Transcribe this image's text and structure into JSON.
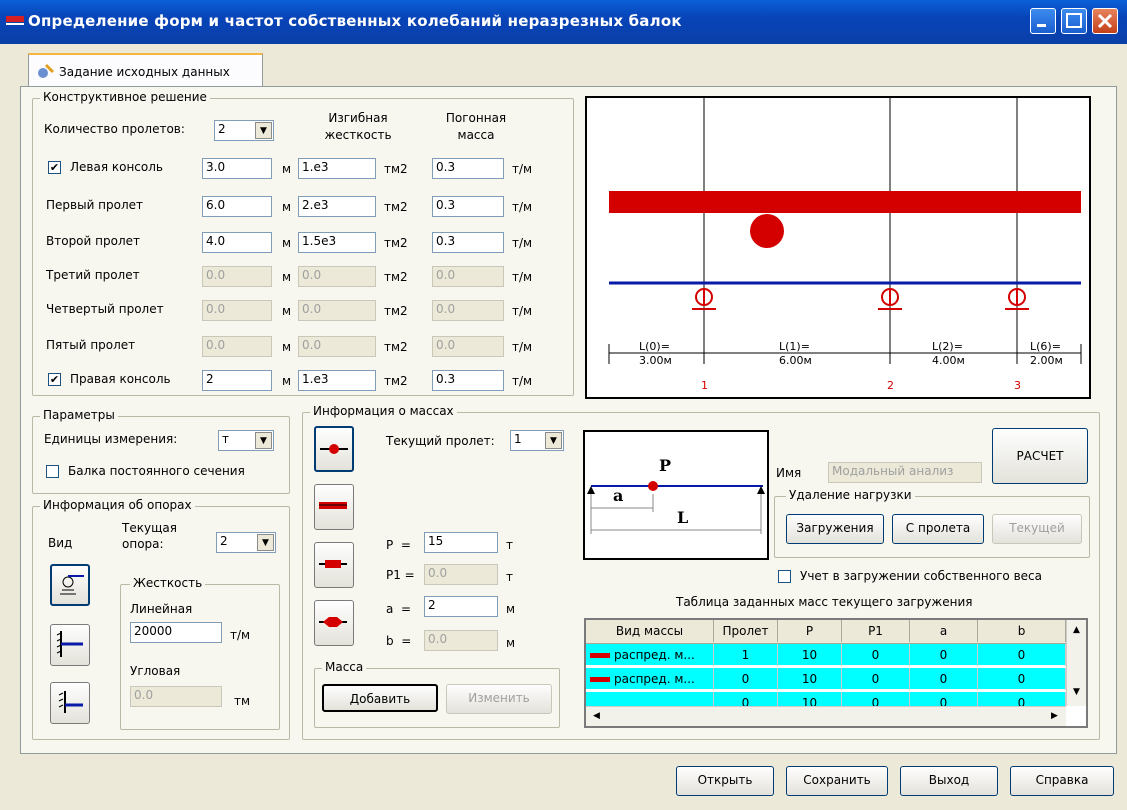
{
  "window": {
    "title": "Определение форм и частот собственных колебаний неразрезных балок"
  },
  "tab": {
    "label": "Задание исходных данных"
  },
  "structure": {
    "group_label": "Конструктивное решение",
    "span_count_label": "Количество пролетов:",
    "span_count_value": "2",
    "col_stiffness": "Изгибная\nжесткость",
    "col_mass": "Погонная\nмасса",
    "rows": [
      {
        "label": "Левая консоль",
        "checkbox": true,
        "checked": true,
        "len": "3.0",
        "stiff": "1.e3",
        "mass": "0.3",
        "enabled": true
      },
      {
        "label": "Первый пролет",
        "checkbox": false,
        "len": "6.0",
        "stiff": "2.e3",
        "mass": "0.3",
        "enabled": true
      },
      {
        "label": "Второй пролет",
        "checkbox": false,
        "len": "4.0",
        "stiff": "1.5e3",
        "mass": "0.3",
        "enabled": true
      },
      {
        "label": "Третий пролет",
        "checkbox": false,
        "len": "0.0",
        "stiff": "0.0",
        "mass": "0.0",
        "enabled": false
      },
      {
        "label": "Четвертый пролет",
        "checkbox": false,
        "len": "0.0",
        "stiff": "0.0",
        "mass": "0.0",
        "enabled": false
      },
      {
        "label": "Пятый пролет",
        "checkbox": false,
        "len": "0.0",
        "stiff": "0.0",
        "mass": "0.0",
        "enabled": false
      },
      {
        "label": "Правая консоль",
        "checkbox": true,
        "checked": true,
        "len": "2",
        "stiff": "1.e3",
        "mass": "0.3",
        "enabled": true
      }
    ],
    "unit_len": "м",
    "unit_stiff": "тм2",
    "unit_mass": "т/м"
  },
  "diagram": {
    "labels": [
      {
        "top": "L(0)=",
        "bottom": "3.00м"
      },
      {
        "top": "L(1)=",
        "bottom": "6.00м"
      },
      {
        "top": "L(2)=",
        "bottom": "4.00м"
      },
      {
        "top": "L(6)=",
        "bottom": "2.00м"
      }
    ],
    "support_numbers": [
      "1",
      "2",
      "3"
    ],
    "colors": {
      "beam": "#d40000",
      "axis": "#0a1aa8"
    }
  },
  "params": {
    "group_label": "Параметры",
    "units_label": "Единицы измерения:",
    "units_value": "т",
    "constant_section_label": "Балка постоянного сечения"
  },
  "supports": {
    "group_label": "Информация об опорах",
    "view_label": "Вид",
    "current_label": "Текущая\nопора:",
    "current_value": "2",
    "stiffness_group": "Жесткость",
    "linear_label": "Линейная",
    "linear_value": "20000",
    "linear_unit": "т/м",
    "angular_label": "Угловая",
    "angular_value": "0.0",
    "angular_unit": "тм"
  },
  "masses": {
    "group_label": "Информация о массах",
    "current_span_label": "Текущий пролет:",
    "current_span_value": "1",
    "P_label": "P  =",
    "P_value": "15",
    "P_unit": "т",
    "P1_label": "P1 =",
    "P1_value": "0.0",
    "P1_unit": "т",
    "a_label": "a  =",
    "a_value": "2",
    "a_unit": "м",
    "b_label": "b  =",
    "b_value": "0.0",
    "b_unit": "м",
    "mass_group": "Масса",
    "add_button": "Добавить",
    "edit_button": "Изменить"
  },
  "scheme": {
    "P": "P",
    "a": "a",
    "L": "L"
  },
  "right": {
    "name_label": "Имя",
    "name_placeholder": "Модальный анализ",
    "calc_button": "РАСЧЕТ",
    "remove_group": "Удаление нагрузки",
    "remove_load": "Загружения",
    "remove_span": "С пролета",
    "remove_current": "Текущей",
    "self_weight_label": "Учет в загружении собственного веса",
    "table_title": "Таблица заданных масс текущего загружения"
  },
  "table": {
    "headers": [
      "Вид массы",
      "Пролет",
      "P",
      "P1",
      "a",
      "b"
    ],
    "rows": [
      [
        "распред. м...",
        "1",
        "10",
        "0",
        "0",
        "0"
      ],
      [
        "распред. м...",
        "0",
        "10",
        "0",
        "0",
        "0"
      ],
      [
        "",
        "0",
        "10",
        "0",
        "0",
        "0"
      ]
    ],
    "row_color": "#00ffff"
  },
  "footer": {
    "open": "Открыть",
    "save": "Сохранить",
    "exit": "Выход",
    "help": "Справка"
  }
}
